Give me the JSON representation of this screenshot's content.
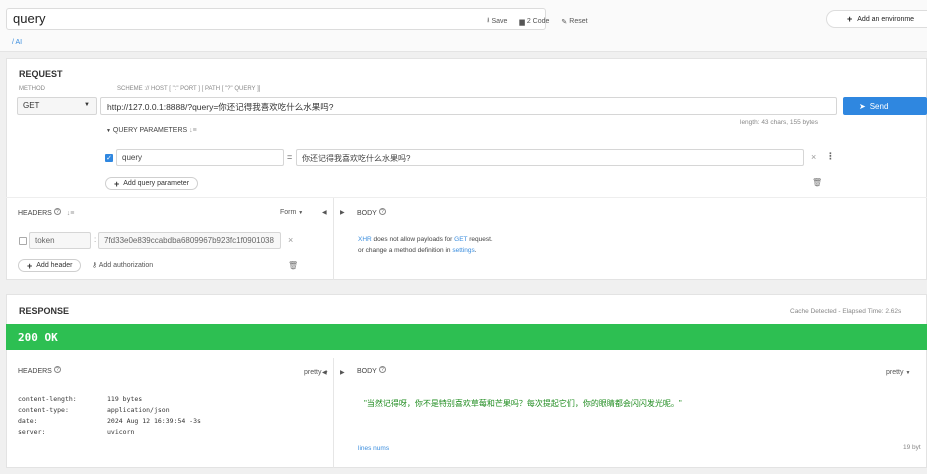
{
  "top": {
    "request_name": "query",
    "save": "Save",
    "code": "2 Code",
    "reset": "Reset",
    "environment": "Add an environme",
    "breadcrumb": "/ AI"
  },
  "request": {
    "title": "REQUEST",
    "method_label": "METHOD",
    "scheme_label": "SCHEME :// HOST [ \":\" PORT ] [ PATH [ \"?\" QUERY ]]",
    "method": "GET",
    "url": "http://127.0.0.1:8888/?query=你还记得我喜欢吃什么水果吗?",
    "length": "length: 43 chars, 155 bytes",
    "send": "Send",
    "query_params_label": "QUERY PARAMETERS",
    "sort_icon": "↓≡",
    "params": [
      {
        "enabled": true,
        "name": "query",
        "value": "你还记得我喜欢吃什么水果吗?"
      }
    ],
    "add_param": "Add query parameter",
    "headers_label": "HEADERS",
    "form_label": "Form",
    "body_label": "BODY",
    "headers": [
      {
        "enabled": false,
        "name": "token",
        "value": "7fd33e0e839ccabdba6809967b923fc1f0901038"
      }
    ],
    "add_header": "Add header",
    "add_auth": "Add authorization",
    "body_msg_1": "does not allow payloads for",
    "body_msg_xhr": "XHR",
    "body_msg_get": "GET",
    "body_msg_request": "request.",
    "body_msg_2": "or change a method definition in",
    "body_msg_settings": "settings",
    "body_msg_dot": "."
  },
  "response": {
    "title": "RESPONSE",
    "cache": "Cache Detected - Elapsed Time: 2.62s",
    "status": "200 OK",
    "headers_label": "HEADERS",
    "pretty": "pretty",
    "body_label": "BODY",
    "headers": [
      {
        "key": "content-length:",
        "value": "119 bytes"
      },
      {
        "key": "content-type:",
        "value": "application/json"
      },
      {
        "key": "date:",
        "value": "2024 Aug 12 16:39:54 -3s"
      },
      {
        "key": "server:",
        "value": "uvicorn"
      }
    ],
    "body": "\"当然记得呀，你不是特别喜欢草莓和芒果吗？每次提起它们，你的眼睛都会闪闪发光呢。\"",
    "lines_nums": "lines nums",
    "size": "19 byt"
  },
  "colors": {
    "accent": "#2f87e0",
    "success": "#2dbf52",
    "body_text": "#1f8c1f"
  }
}
